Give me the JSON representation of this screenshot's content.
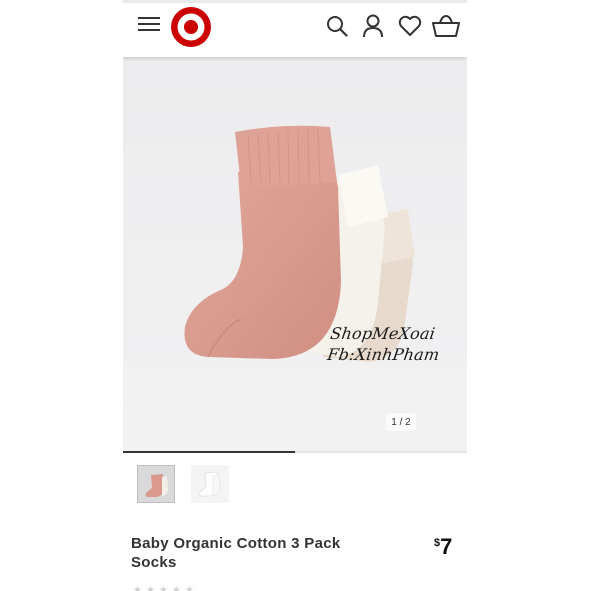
{
  "brand": {
    "name": "Target",
    "color": "#cc0000",
    "icon": "bullseye-logo-icon"
  },
  "header": {
    "icons": [
      "hamburger-menu-icon",
      "search-icon",
      "account-icon",
      "heart-icon",
      "cart-icon"
    ]
  },
  "gallery": {
    "watermark_line1": "ShopMeXoai",
    "watermark_line2": "Fb:XinhPham",
    "pager_text": "1 / 2",
    "current_image": 1,
    "total_images": 2,
    "progress_fraction": 0.5,
    "thumbnails": [
      "pink-socks-thumbnail",
      "white-socks-thumbnail"
    ]
  },
  "product": {
    "title": "Baby Organic Cotton 3 Pack Socks",
    "price_currency": "$",
    "price_amount": "7",
    "rating_stars": "★★★★★"
  },
  "colors": {
    "accent": "#cc0000",
    "sock_pink": "#d99a8d",
    "sock_white": "#f4f1ea",
    "sock_beige": "#e6d8cb"
  }
}
